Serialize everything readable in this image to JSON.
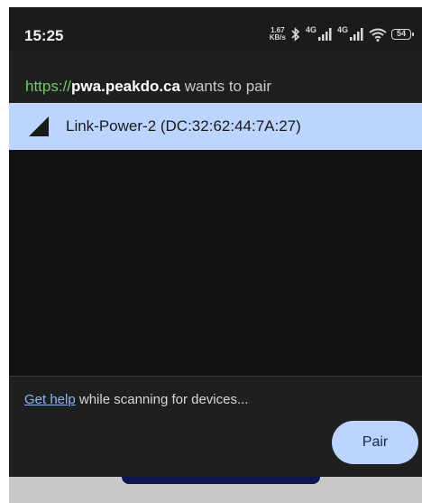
{
  "status_bar": {
    "time": "15:25",
    "net_speed_value": "1.67",
    "net_speed_unit": "KB/s",
    "sim1_label": "4G",
    "sim2_label": "4G",
    "battery": "54"
  },
  "dialog": {
    "origin_scheme": "https://",
    "origin_host": "pwa.peakdo.ca",
    "origin_suffix": " wants to pair",
    "devices": [
      {
        "label": "Link-Power-2 (DC:32:62:44:7A:27)",
        "icon": "signal-strength-icon",
        "selected": true
      }
    ],
    "help_link": "Get help",
    "help_text": " while scanning for devices...",
    "pair_button": "Pair"
  },
  "colors": {
    "accent": "#bcd5ff",
    "link": "#8ab4f8",
    "secure_scheme": "#6fc96f",
    "background": "#1f1f1f"
  }
}
